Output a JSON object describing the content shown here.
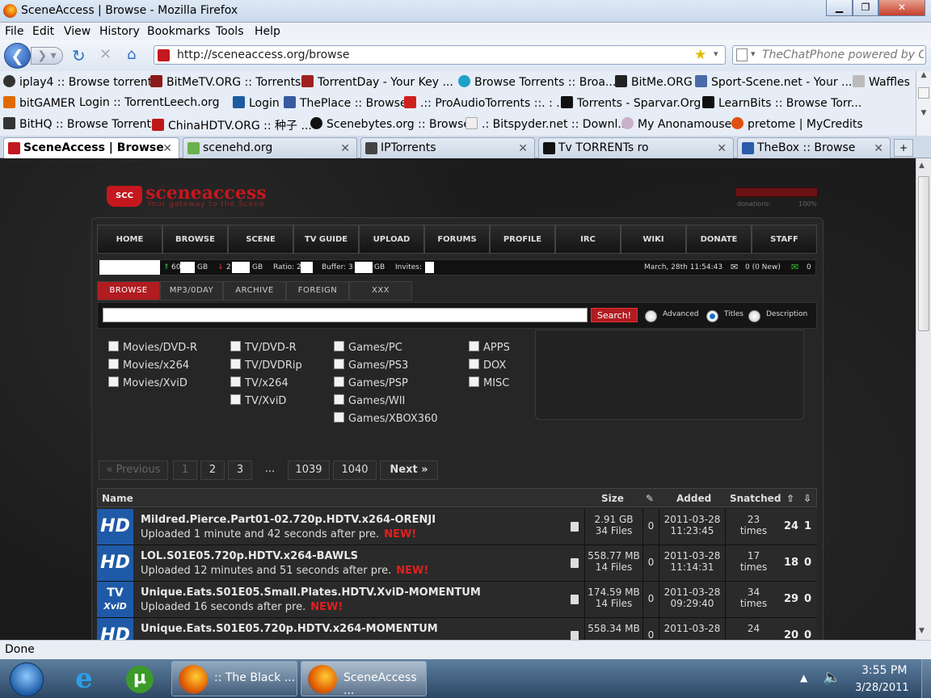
{
  "window": {
    "title": "SceneAccess | Browse - Mozilla Firefox"
  },
  "menu": [
    "File",
    "Edit",
    "View",
    "History",
    "Bookmarks",
    "Tools",
    "Help"
  ],
  "nav": {
    "url": "http://sceneaccess.org/browse",
    "search_placeholder": "TheChatPhone powered by C"
  },
  "bookmarks": [
    [
      "iplay4 :: Browse torrents",
      "BitMeTV.ORG :: Torrents",
      "TorrentDay - Your Key ...",
      "Browse Torrents :: Broa...",
      "BitMe.ORG",
      "Sport-Scene.net - Your ...",
      "Waffles"
    ],
    [
      "bitGAMER",
      "Login :: TorrentLeech.org",
      "Login",
      "ThePlace :: Browse",
      ".:: ProAudioTorrents ::. : ...",
      "Torrents - Sparvar.Org",
      "LearnBits :: Browse Torr..."
    ],
    [
      "BitHQ :: Browse Torrents",
      "ChinaHDTV.ORG :: 种子 ...",
      "Scenebytes.org :: Browse",
      ".: Bitspyder.net :: Downl...",
      "My Anonamouse",
      "pretome | MyCredits"
    ]
  ],
  "tabs": [
    "SceneAccess | Browse",
    "scenehd.org",
    "IPTorrents",
    "Tv TORRENTs ro",
    "TheBox :: Browse"
  ],
  "site": {
    "logo": "sceneaccess",
    "tagline": "Your gateway to the Scene",
    "donations_label": "donations:",
    "donations_pct": "100%",
    "nav": [
      "HOME",
      "BROWSE",
      "SCENE",
      "TV GUIDE",
      "UPLOAD",
      "FORUMS",
      "PROFILE",
      "IRC",
      "WIKI",
      "DONATE",
      "STAFF"
    ],
    "info": {
      "up": "60",
      "up_unit": "GB",
      "down": "2",
      "down_unit": "GB",
      "ratio": "Ratio: 2.",
      "buffer": "Buffer: 3",
      "buffer_unit": "GB",
      "invites": "Invites:",
      "date": "March, 28th 11:54:43",
      "mail": "0 (0 New)",
      "pm": "0"
    },
    "subtabs": [
      "BROWSE",
      "MP3/0DAY",
      "ARCHIVE",
      "FOREIGN",
      "XXX"
    ],
    "search": {
      "button": "Search!",
      "advanced": "Advanced",
      "titles": "Titles",
      "description": "Description"
    },
    "categories": [
      [
        "Movies/DVD-R",
        "Movies/x264",
        "Movies/XviD"
      ],
      [
        "TV/DVD-R",
        "TV/DVDRip",
        "TV/x264",
        "TV/XviD"
      ],
      [
        "Games/PC",
        "Games/PS3",
        "Games/PSP",
        "Games/WII",
        "Games/XBOX360"
      ],
      [
        "APPS",
        "DOX",
        "MISC"
      ]
    ],
    "pagination": [
      "« Previous",
      "1",
      "2",
      "3",
      "...",
      "1039",
      "1040",
      "Next »"
    ],
    "table_head": {
      "name": "Name",
      "size": "Size",
      "added": "Added",
      "snatched": "Snatched"
    },
    "rows": [
      {
        "icon": "HD",
        "name": "Mildred.Pierce.Part01-02.720p.HDTV.x264-ORENJI",
        "sub": "Uploaded 1 minute and 42 seconds after pre.",
        "new": "NEW!",
        "size": "2.91 GB",
        "files": "34 Files",
        "comments": "0",
        "date": "2011-03-28",
        "time": "11:23:45",
        "snatched": "23",
        "times": "times",
        "seed": "24",
        "leech": "1"
      },
      {
        "icon": "HD",
        "name": "LOL.S01E05.720p.HDTV.x264-BAWLS",
        "sub": "Uploaded 12 minutes and 51 seconds after pre.",
        "new": "NEW!",
        "size": "558.77 MB",
        "files": "14 Files",
        "comments": "0",
        "date": "2011-03-28",
        "time": "11:14:31",
        "snatched": "17",
        "times": "times",
        "seed": "18",
        "leech": "0"
      },
      {
        "icon": "TV",
        "icon2": "XviD",
        "name": "Unique.Eats.S01E05.Small.Plates.HDTV.XviD-MOMENTUM",
        "sub": "Uploaded 16 seconds after pre.",
        "new": "NEW!",
        "size": "174.59 MB",
        "files": "14 Files",
        "comments": "0",
        "date": "2011-03-28",
        "time": "09:29:40",
        "snatched": "34",
        "times": "times",
        "seed": "29",
        "leech": "0"
      },
      {
        "icon": "HD",
        "name": "Unique.Eats.S01E05.720p.HDTV.x264-MOMENTUM",
        "sub": "",
        "new": "",
        "size": "558.34 MB",
        "files": "",
        "comments": "0",
        "date": "2011-03-28",
        "time": "",
        "snatched": "24",
        "times": "",
        "seed": "20",
        "leech": "0"
      }
    ]
  },
  "status": "Done",
  "taskbar": {
    "items": [
      ":: The Black ...",
      "SceneAccess ..."
    ],
    "time": "3:55 PM",
    "date": "3/28/2011"
  }
}
